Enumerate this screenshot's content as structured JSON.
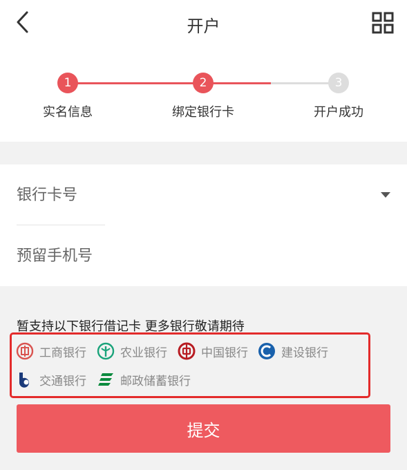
{
  "header": {
    "title": "开户"
  },
  "steps": [
    {
      "number": "1",
      "label": "实名信息"
    },
    {
      "number": "2",
      "label": "绑定银行卡"
    },
    {
      "number": "3",
      "label": "开户成功"
    }
  ],
  "form": {
    "card_number_placeholder": "银行卡号",
    "phone_placeholder": "预留手机号"
  },
  "notice": "暂支持以下银行借记卡 更多银行敬请期待",
  "banks": [
    {
      "name": "工商银行",
      "icon": "icbc-logo-icon",
      "color": "#d9534f"
    },
    {
      "name": "农业银行",
      "icon": "abc-logo-icon",
      "color": "#1aa37a"
    },
    {
      "name": "中国银行",
      "icon": "boc-logo-icon",
      "color": "#b81c22"
    },
    {
      "name": "建设银行",
      "icon": "ccb-logo-icon",
      "color": "#1961ac"
    },
    {
      "name": "交通银行",
      "icon": "bocom-logo-icon",
      "color": "#1a3a7a"
    },
    {
      "name": "邮政储蓄银行",
      "icon": "psbc-logo-icon",
      "color": "#0b8a3e"
    }
  ],
  "submit_label": "提交",
  "colors": {
    "accent": "#e9545a",
    "step_inactive": "#dddddd",
    "highlight_border": "#e32b2b"
  }
}
